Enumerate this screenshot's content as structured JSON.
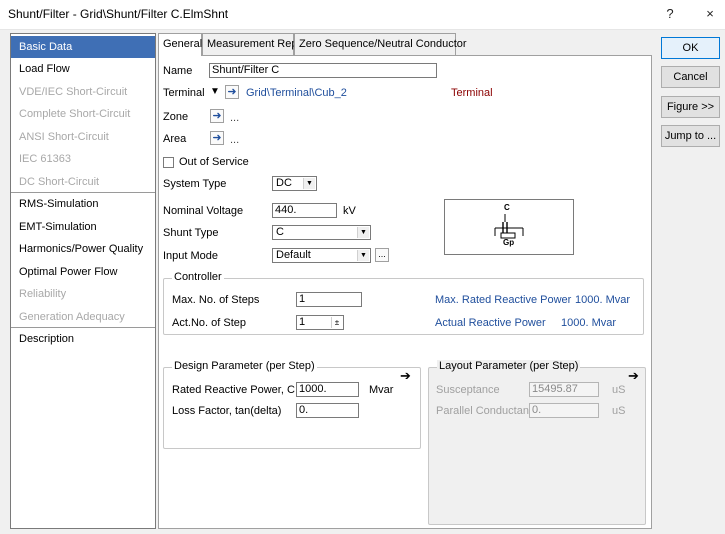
{
  "window": {
    "title": "Shunt/Filter - Grid\\Shunt/Filter C.ElmShnt",
    "help_glyph": "?",
    "close_glyph": "×"
  },
  "sidebar": {
    "items": [
      {
        "label": "Basic Data",
        "state": "active"
      },
      {
        "label": "Load Flow",
        "state": "normal"
      },
      {
        "label": "VDE/IEC Short-Circuit",
        "state": "disabled"
      },
      {
        "label": "Complete Short-Circuit",
        "state": "disabled"
      },
      {
        "label": "ANSI Short-Circuit",
        "state": "disabled"
      },
      {
        "label": "IEC 61363",
        "state": "disabled"
      },
      {
        "label": "DC Short-Circuit",
        "state": "disabled"
      },
      {
        "label": "RMS-Simulation",
        "state": "normal"
      },
      {
        "label": "EMT-Simulation",
        "state": "normal"
      },
      {
        "label": "Harmonics/Power Quality",
        "state": "normal"
      },
      {
        "label": "Optimal Power Flow",
        "state": "normal"
      },
      {
        "label": "Reliability",
        "state": "disabled"
      },
      {
        "label": "Generation Adequacy",
        "state": "disabled"
      },
      {
        "label": "Description",
        "state": "normal"
      }
    ]
  },
  "tabs": [
    {
      "label": "General",
      "active": true
    },
    {
      "label": "Measurement Report",
      "active": false
    },
    {
      "label": "Zero Sequence/Neutral Conductor",
      "active": false
    }
  ],
  "general": {
    "name_label": "Name",
    "name_value": "Shunt/Filter C",
    "terminal_label": "Terminal",
    "terminal_path": "Grid\\Terminal\\Cub_2",
    "terminal_type": "Terminal",
    "zone_label": "Zone",
    "zone_value": "...",
    "area_label": "Area",
    "area_value": "...",
    "out_of_service_label": "Out of Service",
    "system_type_label": "System Type",
    "system_type_value": "DC",
    "nominal_voltage_label": "Nominal Voltage",
    "nominal_voltage_value": "440.",
    "nominal_voltage_unit": "kV",
    "shunt_type_label": "Shunt Type",
    "shunt_type_value": "C",
    "input_mode_label": "Input Mode",
    "input_mode_value": "Default",
    "ellipsis": "...",
    "diagram_label_c": "C",
    "diagram_label_gp": "Gp"
  },
  "controller": {
    "title": "Controller",
    "max_steps_label": "Max. No. of Steps",
    "max_steps_value": "1",
    "act_step_label": "Act.No. of Step",
    "act_step_value": "1",
    "max_rated_label": "Max. Rated Reactive Power",
    "max_rated_value": "1000. Mvar",
    "actual_label": "Actual Reactive Power",
    "actual_value": "1000. Mvar"
  },
  "design": {
    "title": "Design Parameter (per Step)",
    "rated_label": "Rated Reactive Power, C",
    "rated_value": "1000.",
    "rated_unit": "Mvar",
    "loss_label": "Loss Factor, tan(delta)",
    "loss_value": "0."
  },
  "layout_params": {
    "title": "Layout Parameter (per Step)",
    "susceptance_label": "Susceptance",
    "susceptance_value": "15495.87",
    "susceptance_unit": "uS",
    "parallel_label": "Parallel Conductance",
    "parallel_value": "0.",
    "parallel_unit": "uS"
  },
  "buttons": {
    "ok": "OK",
    "cancel": "Cancel",
    "figure": "Figure >>",
    "jump": "Jump to ..."
  }
}
